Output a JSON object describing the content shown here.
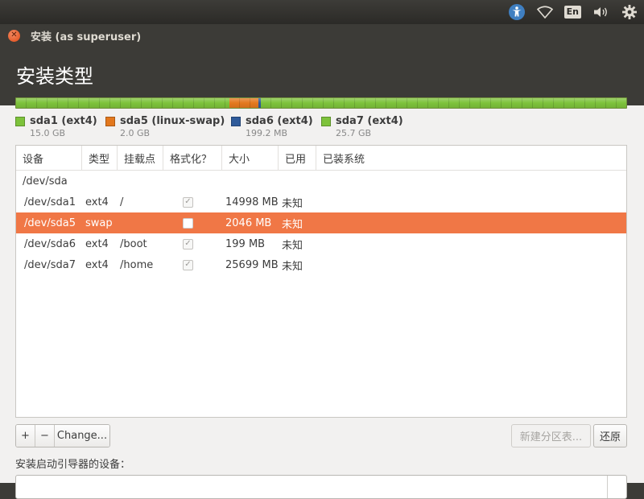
{
  "panel": {
    "language": "En",
    "icons": [
      "accessibility-icon",
      "wifi-icon",
      "language-indicator",
      "volume-icon",
      "gear-icon"
    ]
  },
  "window": {
    "title": "安装 (as superuser)",
    "heading": "安装类型"
  },
  "partition_bar": {
    "segments": [
      {
        "name": "sda1",
        "size_mb": 14998,
        "color": "#7dc23b"
      },
      {
        "name": "sda5",
        "size_mb": 2046,
        "color": "#e3781e"
      },
      {
        "name": "sda6",
        "size_mb": 199,
        "color": "#2f5b9a"
      },
      {
        "name": "sda7",
        "size_mb": 25699,
        "color": "#7dc23b"
      }
    ]
  },
  "legend": [
    {
      "label": "sda1 (ext4)",
      "size": "15.0 GB",
      "color": "#7dc23b"
    },
    {
      "label": "sda5 (linux-swap)",
      "size": "2.0 GB",
      "color": "#e3781e"
    },
    {
      "label": "sda6 (ext4)",
      "size": "199.2 MB",
      "color": "#2f5b9a"
    },
    {
      "label": "sda7 (ext4)",
      "size": "25.7 GB",
      "color": "#7dc23b"
    }
  ],
  "table": {
    "columns": [
      "设备",
      "类型",
      "挂载点",
      "格式化？",
      "大小",
      "已用",
      "已装系统"
    ],
    "disk": "/dev/sda",
    "rows": [
      {
        "device": "/dev/sda1",
        "type": "ext4",
        "mount": "/",
        "format": true,
        "size": "14998 MB",
        "used": "未知",
        "system": "",
        "selected": false
      },
      {
        "device": "/dev/sda5",
        "type": "swap",
        "mount": "",
        "format": false,
        "size": "2046 MB",
        "used": "未知",
        "system": "",
        "selected": true
      },
      {
        "device": "/dev/sda6",
        "type": "ext4",
        "mount": "/boot",
        "format": true,
        "size": "199 MB",
        "used": "未知",
        "system": "",
        "selected": false
      },
      {
        "device": "/dev/sda7",
        "type": "ext4",
        "mount": "/home",
        "format": true,
        "size": "25699 MB",
        "used": "未知",
        "system": "",
        "selected": false
      }
    ]
  },
  "controls": {
    "add_label": "+",
    "remove_label": "−",
    "change_label": "Change...",
    "new_table_label": "新建分区表...",
    "revert_label": "还原",
    "boot_loader_label": "安装启动引导器的设备："
  },
  "colors": {
    "accent": "#f07746",
    "header_bg": "#3c3b37"
  }
}
